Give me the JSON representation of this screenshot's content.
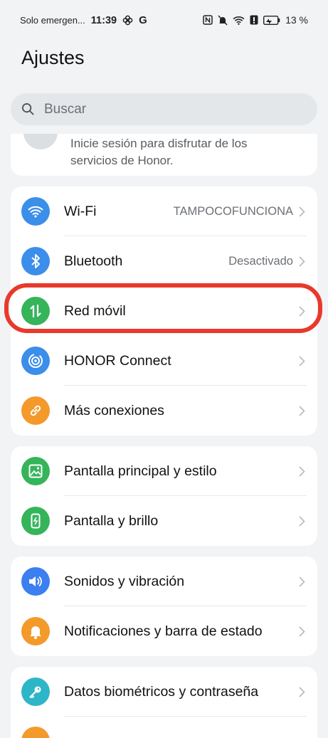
{
  "status_bar": {
    "carrier": "Solo emergen...",
    "time": "11:39",
    "battery_percent": "13 %"
  },
  "page_title": "Ajustes",
  "search": {
    "placeholder": "Buscar"
  },
  "account": {
    "text": "Inicie sesión para disfrutar de los servicios de Honor."
  },
  "groups": [
    {
      "items": [
        {
          "label": "Wi-Fi",
          "value": "TAMPOCOFUNCIONA",
          "icon": "wifi-icon",
          "color": "#3b8eea"
        },
        {
          "label": "Bluetooth",
          "value": "Desactivado",
          "icon": "bluetooth-icon",
          "color": "#3b8eea"
        },
        {
          "label": "Red móvil",
          "value": "",
          "icon": "mobile-data-icon",
          "color": "#35b45a",
          "highlighted": true
        },
        {
          "label": "HONOR Connect",
          "value": "",
          "icon": "honor-connect-icon",
          "color": "#3b8eea"
        },
        {
          "label": "Más conexiones",
          "value": "",
          "icon": "link-icon",
          "color": "#f39a2b"
        }
      ]
    },
    {
      "items": [
        {
          "label": "Pantalla principal y estilo",
          "value": "",
          "icon": "image-icon",
          "color": "#35b45a"
        },
        {
          "label": "Pantalla y brillo",
          "value": "",
          "icon": "phone-brightness-icon",
          "color": "#35b45a"
        }
      ]
    },
    {
      "items": [
        {
          "label": "Sonidos y vibración",
          "value": "",
          "icon": "speaker-icon",
          "color": "#3b7ff0"
        },
        {
          "label": "Notificaciones y barra de estado",
          "value": "",
          "icon": "bell-icon",
          "color": "#f39a2b"
        }
      ]
    },
    {
      "items": [
        {
          "label": "Datos biométricos y contraseña",
          "value": "",
          "icon": "key-icon",
          "color": "#2fb5c8"
        }
      ]
    }
  ],
  "colors": {
    "highlight": "#e8392c",
    "background": "#f1f3f5"
  }
}
